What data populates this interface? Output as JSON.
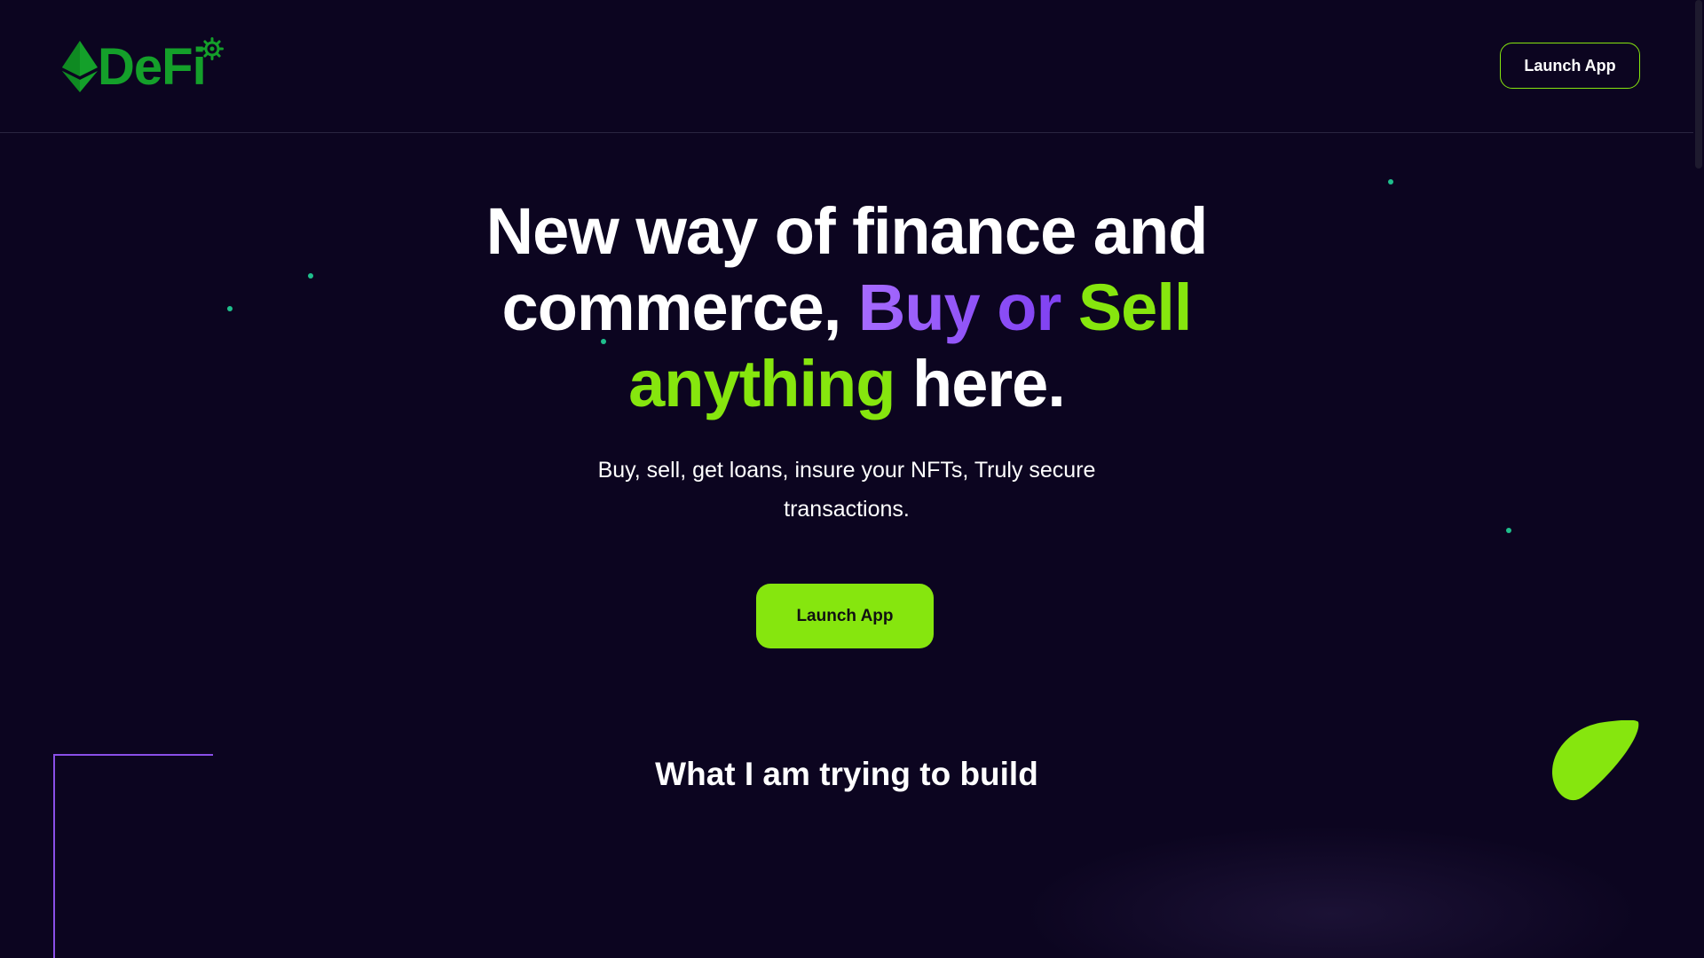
{
  "header": {
    "logo_text": "DeFi",
    "launch_button_label": "Launch App"
  },
  "hero": {
    "title_part1": "New way of finance and commerce, ",
    "title_purple": "Buy or ",
    "title_green": "Sell anything",
    "title_part2": " here.",
    "subtitle": "Buy, sell, get loans, insure your NFTs, Truly secure transactions.",
    "launch_button_label": "Launch App"
  },
  "section": {
    "title": "What I am trying to build"
  },
  "colors": {
    "background": "#0c0520",
    "accent_green": "#86e60e",
    "accent_purple": "#8a4fe8",
    "logo_green": "#14a02a",
    "dot_teal": "#1fbf8c"
  },
  "icons": {
    "logo_gem": "ethereum-diamond-icon",
    "logo_gear": "gear-icon"
  }
}
